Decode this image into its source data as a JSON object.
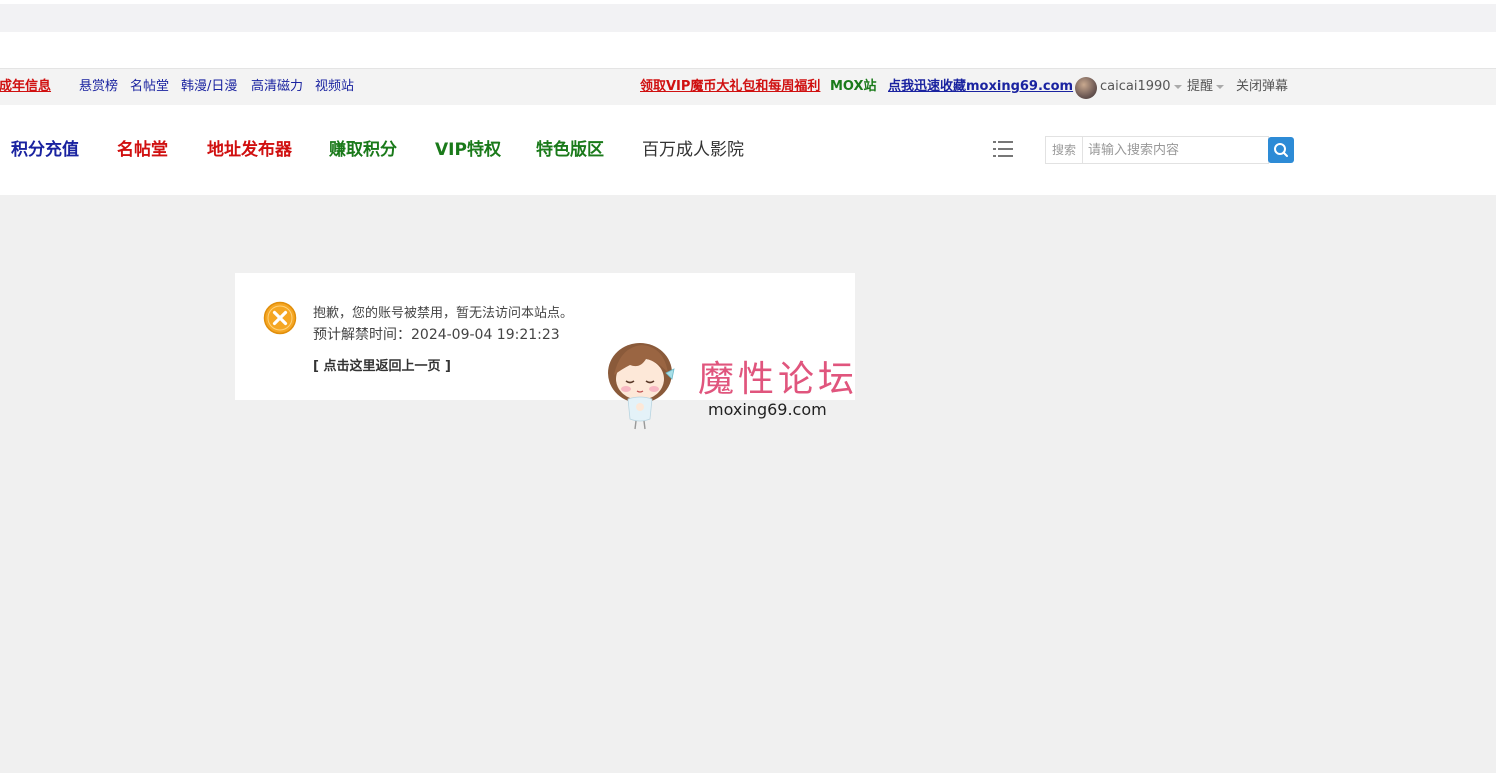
{
  "toolbar": {
    "links": [
      {
        "label": "未成年信息"
      },
      {
        "label": "悬赏榜"
      },
      {
        "label": "名帖堂"
      },
      {
        "label": "韩漫/日漫"
      },
      {
        "label": "高清磁力"
      },
      {
        "label": "视频站"
      }
    ],
    "promo_vip": "领取VIP魔币大礼包和每周福利",
    "promo_mox": "MOX站",
    "promo_bookmark": "点我迅速收藏moxing69.com",
    "username": "caicai1990",
    "reminder": "提醒",
    "close_danmaku": "关闭弹幕"
  },
  "nav": {
    "items": [
      {
        "label": "积分充值",
        "color": "#1a23a0"
      },
      {
        "label": "名帖堂",
        "color": "#d01010"
      },
      {
        "label": "地址发布器",
        "color": "#d01010"
      },
      {
        "label": "赚取积分",
        "color": "#1a7a1a"
      },
      {
        "label": "VIP特权",
        "color": "#1a7a1a"
      },
      {
        "label": "特色版区",
        "color": "#1a7a1a"
      },
      {
        "label": "百万成人影院",
        "color": "#333333"
      }
    ],
    "menu_icon": "list-icon",
    "search_label": "搜索",
    "search_placeholder": "请输入搜索内容",
    "search_icon": "search-icon"
  },
  "message": {
    "icon": "error-icon",
    "line1": "抱歉，您的账号被禁用，暂无法访问本站点。",
    "line2": "预计解禁时间：2024-09-04 19:21:23",
    "back_link": "[ 点击这里返回上一页 ]"
  },
  "watermark": {
    "title": "魔性论坛",
    "url": "moxing69.com"
  },
  "colors": {
    "accent": "#2d8bd6",
    "error_orange": "#f5a623",
    "watermark_pink": "#e0557d"
  }
}
